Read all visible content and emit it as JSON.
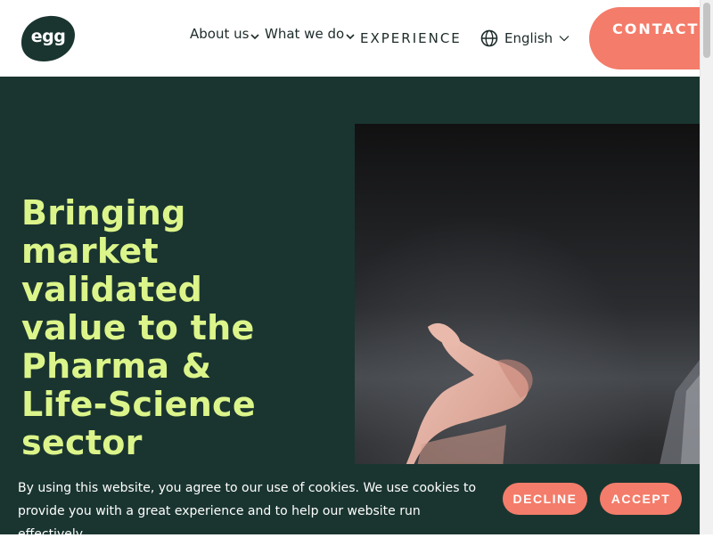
{
  "header": {
    "logo_text": "egg",
    "nav": [
      {
        "label": "About us",
        "icon": "chevron-down-icon"
      },
      {
        "label": "What we do",
        "icon": "chevron-down-icon"
      },
      {
        "label": "EXPERIENCE"
      }
    ],
    "language": {
      "label": "English",
      "icon": "globe-icon"
    },
    "contact_label": "CONTACT US"
  },
  "hero": {
    "title": "Bringing market validated value to the Pharma & Life-Science sector"
  },
  "cookie_banner": {
    "text": "By using this website, you agree to our use of cookies. We use cookies to provide you with a great experience and to help our website run effectively.",
    "decline_label": "DECLINE",
    "accept_label": "ACCEPT"
  },
  "colors": {
    "brand_dark": "#1a3530",
    "accent_lime": "#dcf58a",
    "accent_coral": "#f47c6a"
  }
}
